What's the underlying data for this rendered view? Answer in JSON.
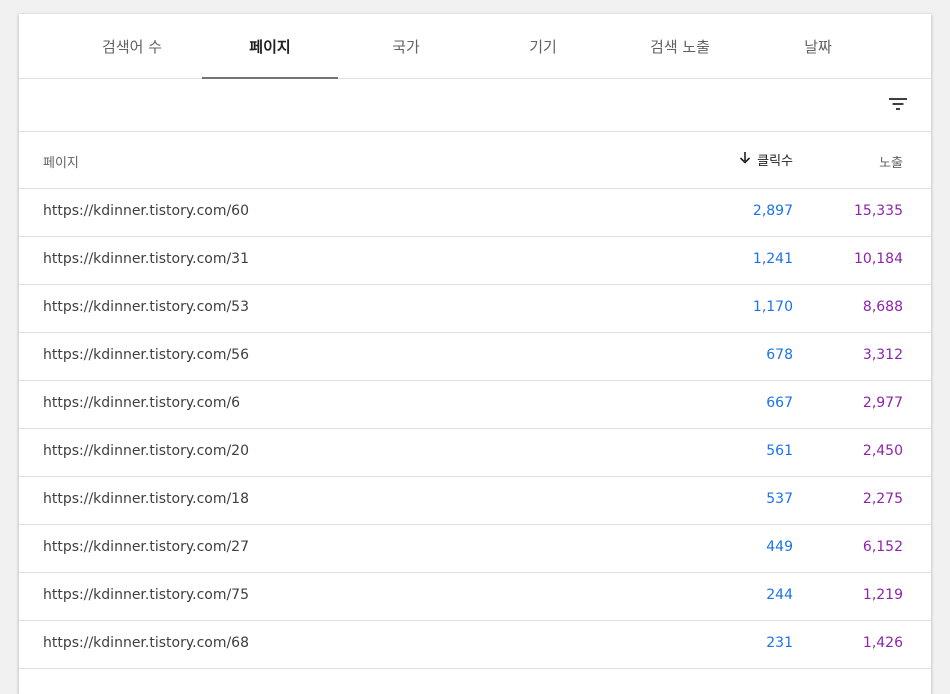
{
  "tabs": [
    {
      "label": "검색어 수"
    },
    {
      "label": "페이지"
    },
    {
      "label": "국가"
    },
    {
      "label": "기기"
    },
    {
      "label": "검색 노출"
    },
    {
      "label": "날짜"
    }
  ],
  "active_tab": "페이지",
  "toolbar": {
    "filter_icon": "filter-list-icon"
  },
  "table": {
    "columns": {
      "page": "페이지",
      "clicks": "클릭수",
      "impressions": "노출"
    },
    "sort_icon": "arrow-down-icon",
    "rows": [
      {
        "url": "https://kdinner.tistory.com/60",
        "clicks": "2,897",
        "impressions": "15,335"
      },
      {
        "url": "https://kdinner.tistory.com/31",
        "clicks": "1,241",
        "impressions": "10,184"
      },
      {
        "url": "https://kdinner.tistory.com/53",
        "clicks": "1,170",
        "impressions": "8,688"
      },
      {
        "url": "https://kdinner.tistory.com/56",
        "clicks": "678",
        "impressions": "3,312"
      },
      {
        "url": "https://kdinner.tistory.com/6",
        "clicks": "667",
        "impressions": "2,977"
      },
      {
        "url": "https://kdinner.tistory.com/20",
        "clicks": "561",
        "impressions": "2,450"
      },
      {
        "url": "https://kdinner.tistory.com/18",
        "clicks": "537",
        "impressions": "2,275"
      },
      {
        "url": "https://kdinner.tistory.com/27",
        "clicks": "449",
        "impressions": "6,152"
      },
      {
        "url": "https://kdinner.tistory.com/75",
        "clicks": "244",
        "impressions": "1,219"
      },
      {
        "url": "https://kdinner.tistory.com/68",
        "clicks": "231",
        "impressions": "1,426"
      }
    ]
  },
  "colors": {
    "clicks": "#1a73e8",
    "impressions": "#8e24aa",
    "active_tab_underline": "#757575"
  }
}
